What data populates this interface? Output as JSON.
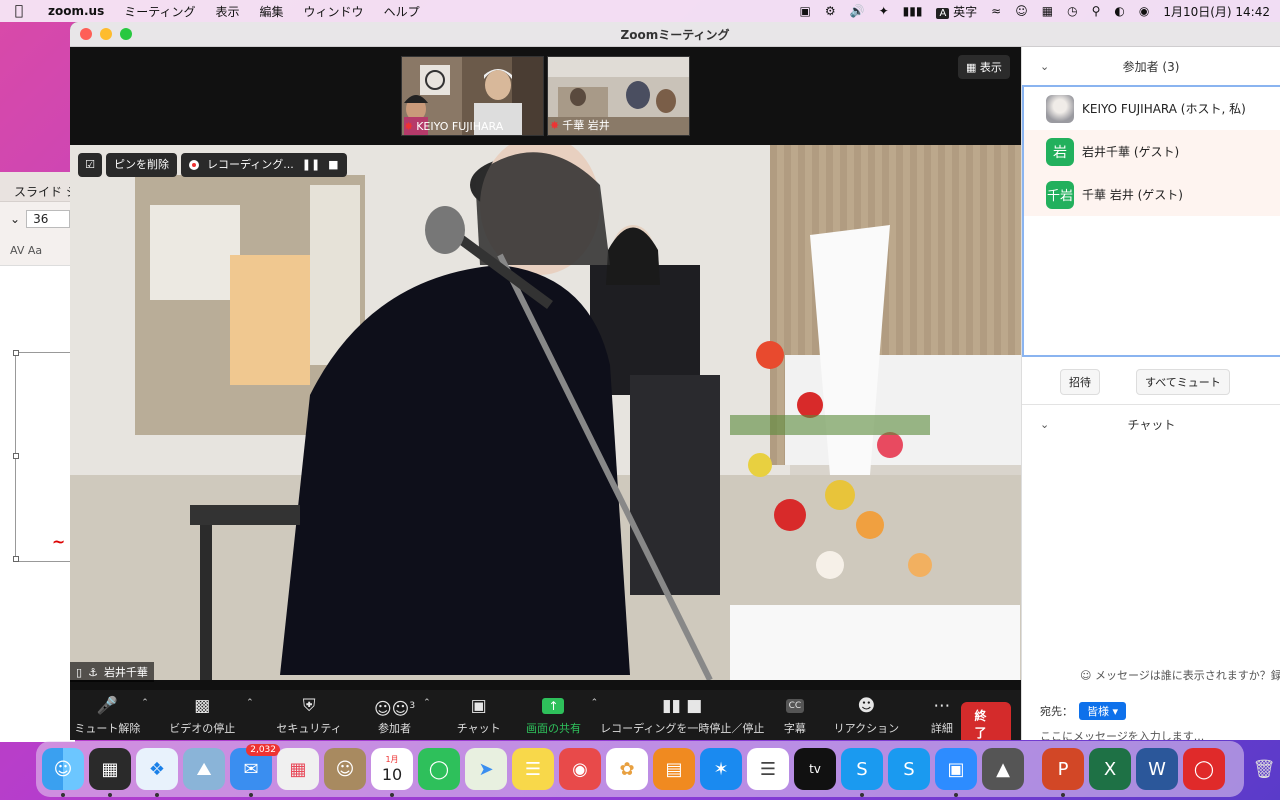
{
  "menubar": {
    "app": "zoom.us",
    "menus": [
      "ミーティング",
      "表示",
      "編集",
      "ウィンドウ",
      "ヘルプ"
    ],
    "ime": "A",
    "ime_label": "英字",
    "datetime": "1月10日(月)  14:42"
  },
  "bgapp": {
    "ribbon_tab": "スライド シ",
    "font_size": "36"
  },
  "window": {
    "title": "Zoomミーティング"
  },
  "thumbs": [
    {
      "name": "KEIYO FUJIHARA"
    },
    {
      "name": "千華 岩井"
    }
  ],
  "view_button": "表示",
  "pinbar": {
    "unpin": "ピンを削除",
    "recording": "レコーディング..."
  },
  "speaker_name": "岩井千華",
  "toolbar": {
    "mute": "ミュート解除",
    "video": "ビデオの停止",
    "security": "セキュリティ",
    "participants": "参加者",
    "participants_count": "3",
    "chat": "チャット",
    "share": "画面の共有",
    "recording": "レコーディングを一時停止／停止",
    "captions": "字幕",
    "captions_icon": "CC",
    "reactions": "リアクション",
    "more": "詳細",
    "end": "終了"
  },
  "panel": {
    "participants_title": "参加者 (3)",
    "participants": [
      {
        "name": "KEIYO FUJIHARA (ホスト, 私)",
        "avatar": ""
      },
      {
        "name": "岩井千華 (ゲスト)",
        "avatar": "岩"
      },
      {
        "name": "千華 岩井 (ゲスト)",
        "avatar": "千岩"
      }
    ],
    "invite": "招待",
    "mute_all": "すべてミュート",
    "chat_title": "チャット",
    "chat_info": "メッセージは誰に表示されますか？録画が",
    "send_to_label": "宛先：",
    "send_to_value": "皆様",
    "input_placeholder": "ここにメッセージを入力します..."
  },
  "dock": {
    "mail_badge": "2,032",
    "calendar_month": "1月",
    "calendar_day": "10"
  },
  "colors": {
    "zoom_green": "#2ec05b",
    "end_red": "#d42b2b",
    "zoom_blue": "#0e71eb"
  }
}
